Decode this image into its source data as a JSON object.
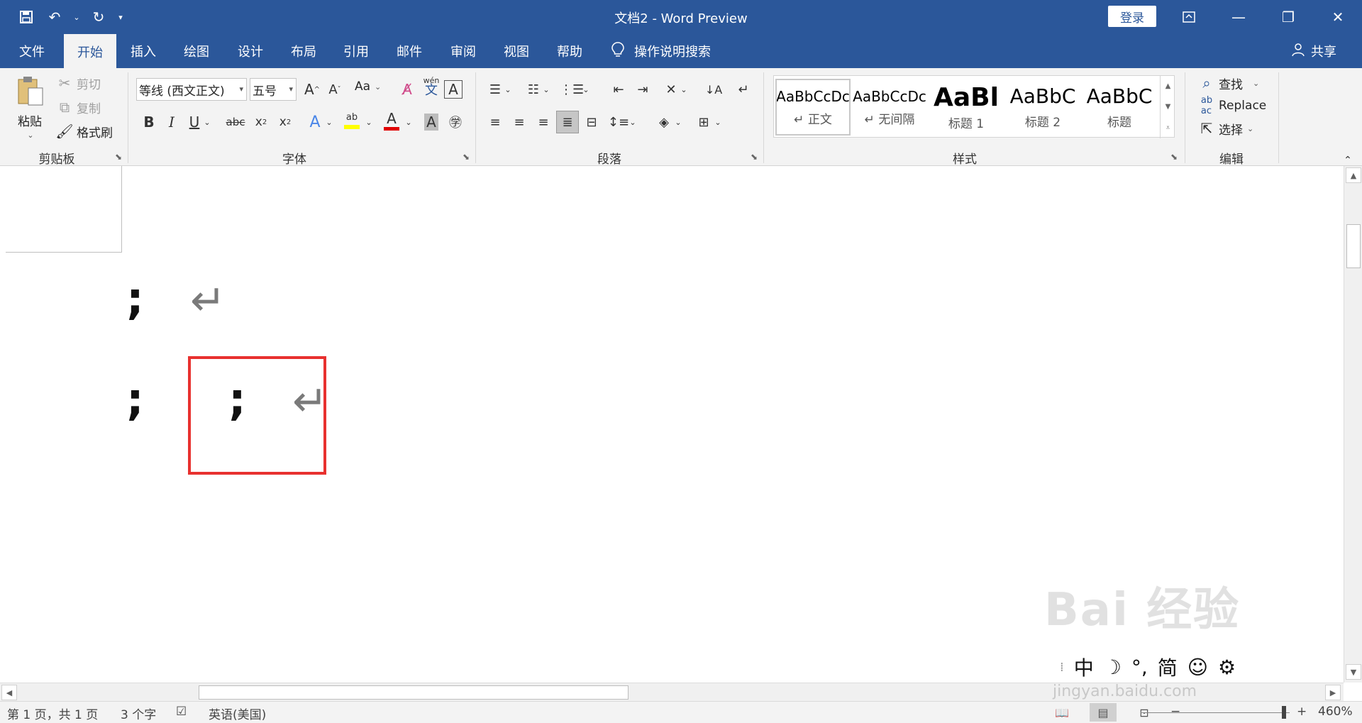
{
  "window": {
    "title": "文档2  -  Word Preview",
    "login_label": "登录"
  },
  "tabs": [
    {
      "label": "文件"
    },
    {
      "label": "开始"
    },
    {
      "label": "插入"
    },
    {
      "label": "绘图"
    },
    {
      "label": "设计"
    },
    {
      "label": "布局"
    },
    {
      "label": "引用"
    },
    {
      "label": "邮件"
    },
    {
      "label": "审阅"
    },
    {
      "label": "视图"
    },
    {
      "label": "帮助"
    }
  ],
  "tell_me": "操作说明搜索",
  "share_label": "共享",
  "clipboard": {
    "paste": "粘贴",
    "cut": "剪切",
    "copy": "复制",
    "format_painter": "格式刷",
    "group_label": "剪贴板"
  },
  "font": {
    "font_name": "等线 (西文正文)",
    "font_size": "五号",
    "case_label": "Aa",
    "phonetic": "wén",
    "phonetic_char": "文",
    "group_label": "字体"
  },
  "paragraph": {
    "group_label": "段落"
  },
  "styles": {
    "group_label": "样式",
    "items": [
      {
        "sample": "AaBbCcDc",
        "name": "↵ 正文"
      },
      {
        "sample": "AaBbCcDc",
        "name": "↵ 无间隔"
      },
      {
        "sample": "AaBl",
        "name": "标题 1"
      },
      {
        "sample": "AaBbC",
        "name": "标题 2"
      },
      {
        "sample": "AaBbC",
        "name": "标题"
      }
    ]
  },
  "editing": {
    "find": "查找",
    "replace": "Replace",
    "select": "选择",
    "group_label": "编辑"
  },
  "document": {
    "line1_char": ";",
    "line2_char_a": ";",
    "line2_char_b": ";",
    "return_mark": "↵"
  },
  "status": {
    "page": "第 1 页，共 1 页",
    "words": "3 个字",
    "language": "英语(美国)",
    "zoom": "460%"
  },
  "ime": {
    "mode": "中",
    "punct": "°,",
    "script": "简"
  },
  "watermark": {
    "brand": "Bai 经验",
    "url": "jingyan.baidu.com"
  },
  "colors": {
    "accent": "#2b579a",
    "highlight_box": "#e8312f"
  }
}
